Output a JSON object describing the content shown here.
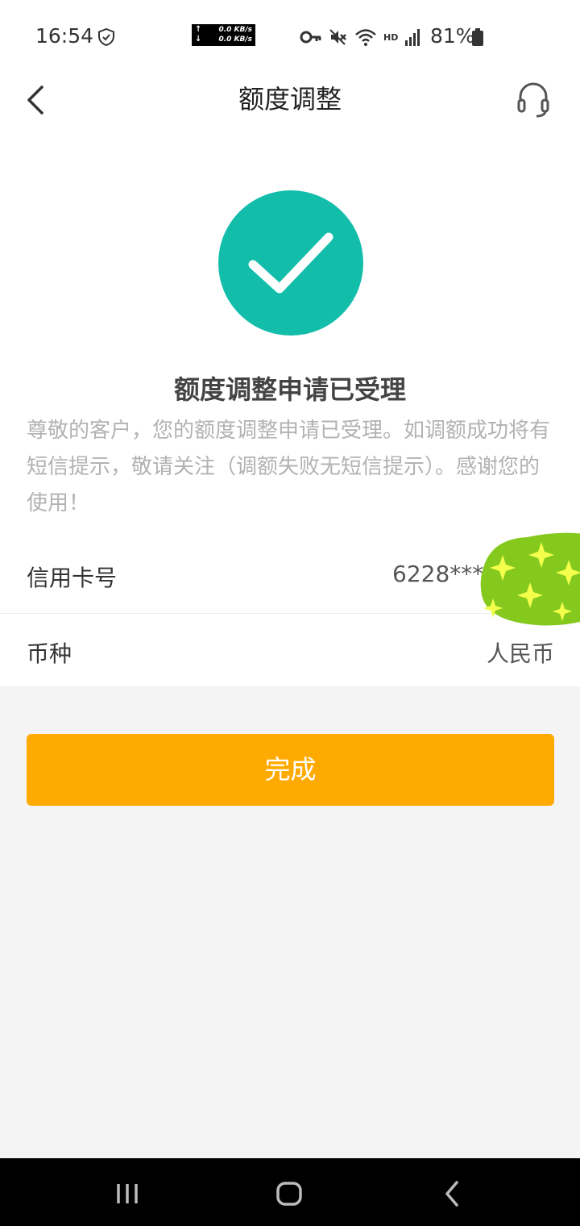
{
  "status_bar": {
    "time": "16:54",
    "net_up": "0.0 KB/s",
    "net_down": "0.0 KB/s",
    "network_type": "HD",
    "battery": "81%"
  },
  "nav": {
    "title": "额度调整",
    "back_icon": "chevron-left-icon",
    "service_icon": "headset-icon"
  },
  "result": {
    "icon": "checkmark-icon",
    "icon_color": "#12bdaa",
    "title": "额度调整申请已受理",
    "description": "尊敬的客户，您的额度调整申请已受理。如调额成功将有短信提示，敬请关注（调额失败无短信提示）。感谢您的使用！"
  },
  "info": {
    "card_label": "信用卡号",
    "card_value": "6228***",
    "currency_label": "币种",
    "currency_value": "人民币"
  },
  "actions": {
    "done_label": "完成",
    "accent_color": "#ffaa00"
  },
  "system_nav": {
    "recents": "recents-icon",
    "home": "home-icon",
    "back": "back-icon"
  }
}
